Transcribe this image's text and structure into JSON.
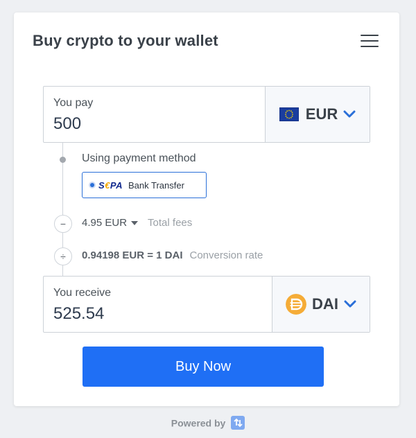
{
  "header": {
    "title": "Buy crypto to your wallet",
    "menu_icon": "hamburger-menu-icon"
  },
  "pay": {
    "label": "You pay",
    "value": "500",
    "currency": "EUR",
    "currency_icon": "eu-flag-icon"
  },
  "payment_method": {
    "label": "Using payment method",
    "brand": "SEPA",
    "name": "Bank Transfer"
  },
  "fees": {
    "value": "4.95 EUR",
    "label": "Total fees",
    "icon": "minus-icon"
  },
  "rate": {
    "value": "0.94198 EUR = 1 DAI",
    "label": "Conversion rate",
    "icon": "divide-icon"
  },
  "receive": {
    "label": "You receive",
    "value": "525.54",
    "currency": "DAI",
    "currency_icon": "dai-coin-icon"
  },
  "buy_button": {
    "label": "Buy Now"
  },
  "footer": {
    "powered_by": "Powered by",
    "logo_icon": "ramp-logo-icon"
  },
  "colors": {
    "accent": "#1f6ff5",
    "chevron": "#2a6fd8",
    "dai": "#f5ac37",
    "background": "#eef0f3"
  }
}
